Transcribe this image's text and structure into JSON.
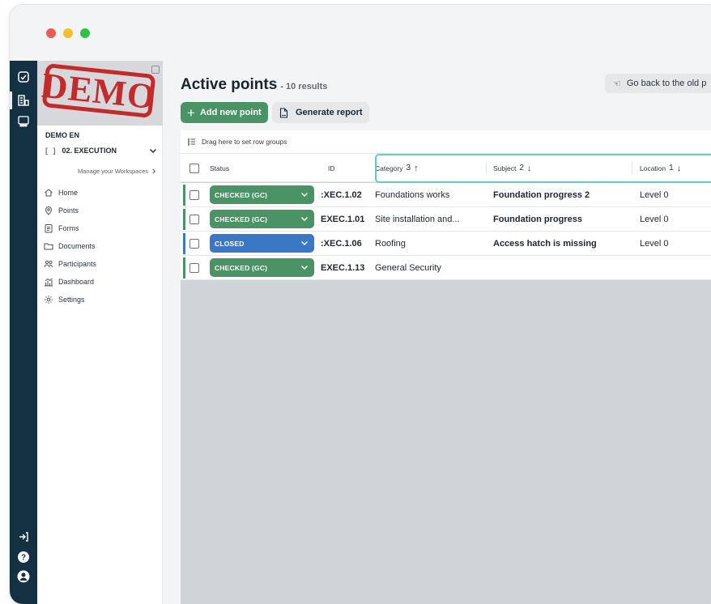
{
  "window": {
    "controls": [
      "close",
      "minimize",
      "maximize"
    ]
  },
  "rail": {
    "top_icons": [
      "checklist-icon",
      "buildings-icon",
      "team-icon"
    ],
    "bottom_icons": [
      "logout-icon",
      "help-icon",
      "user-avatar-icon"
    ]
  },
  "sidebar": {
    "logo_text": "DEMO",
    "workspace_name": "DEMO EN",
    "workspace_bracket": "[ ]",
    "workspace_selected": "02. EXECUTION",
    "manage_label": "Manage your Workspaces",
    "nav": [
      {
        "label": "Home",
        "icon": "home-icon"
      },
      {
        "label": "Points",
        "icon": "pin-icon"
      },
      {
        "label": "Forms",
        "icon": "forms-icon"
      },
      {
        "label": "Documents",
        "icon": "folder-icon"
      },
      {
        "label": "Participants",
        "icon": "participants-icon"
      },
      {
        "label": "Dashboard",
        "icon": "dashboard-icon"
      },
      {
        "label": "Settings",
        "icon": "settings-icon"
      }
    ]
  },
  "page": {
    "title": "Active points",
    "results": "- 10 results",
    "old_platform_label": "Go back to the old p",
    "add_label": "Add new point",
    "report_label": "Generate report"
  },
  "grid": {
    "group_hint": "Drag here to set row groups",
    "columns": [
      {
        "label": "Status",
        "sort_order": "",
        "sort_arrow": ""
      },
      {
        "label": "ID",
        "sort_order": "",
        "sort_arrow": ""
      },
      {
        "label": "Category",
        "sort_order": "3",
        "sort_arrow": "↑"
      },
      {
        "label": "Subject",
        "sort_order": "2",
        "sort_arrow": "↓"
      },
      {
        "label": "Location",
        "sort_order": "1",
        "sort_arrow": "↓"
      }
    ],
    "rows": [
      {
        "status": "CHECKED (GC)",
        "status_color": "#4a9364",
        "id": ":XEC.1.02",
        "category": "Foundations works",
        "subject": "Foundation progress 2",
        "location": "Level 0"
      },
      {
        "status": "CHECKED (GC)",
        "status_color": "#4a9364",
        "id": "EXEC.1.01",
        "category": "Site installation and...",
        "subject": "Foundation progress",
        "location": "Level 0"
      },
      {
        "status": "CLOSED",
        "status_color": "#3a78c6",
        "id": ":XEC.1.06",
        "category": "Roofing",
        "subject": "Access hatch is missing",
        "location": "Level 0"
      },
      {
        "status": "CHECKED (GC)",
        "status_color": "#4a9364",
        "id": "EXEC.1.13",
        "category": "General Security",
        "subject": "",
        "location": ""
      }
    ]
  },
  "colors": {
    "rail": "#143043",
    "accent_green": "#4a9364",
    "status_closed": "#3a78c6",
    "highlight": "#5ccfbd",
    "demo_red": "#c42a2a"
  }
}
